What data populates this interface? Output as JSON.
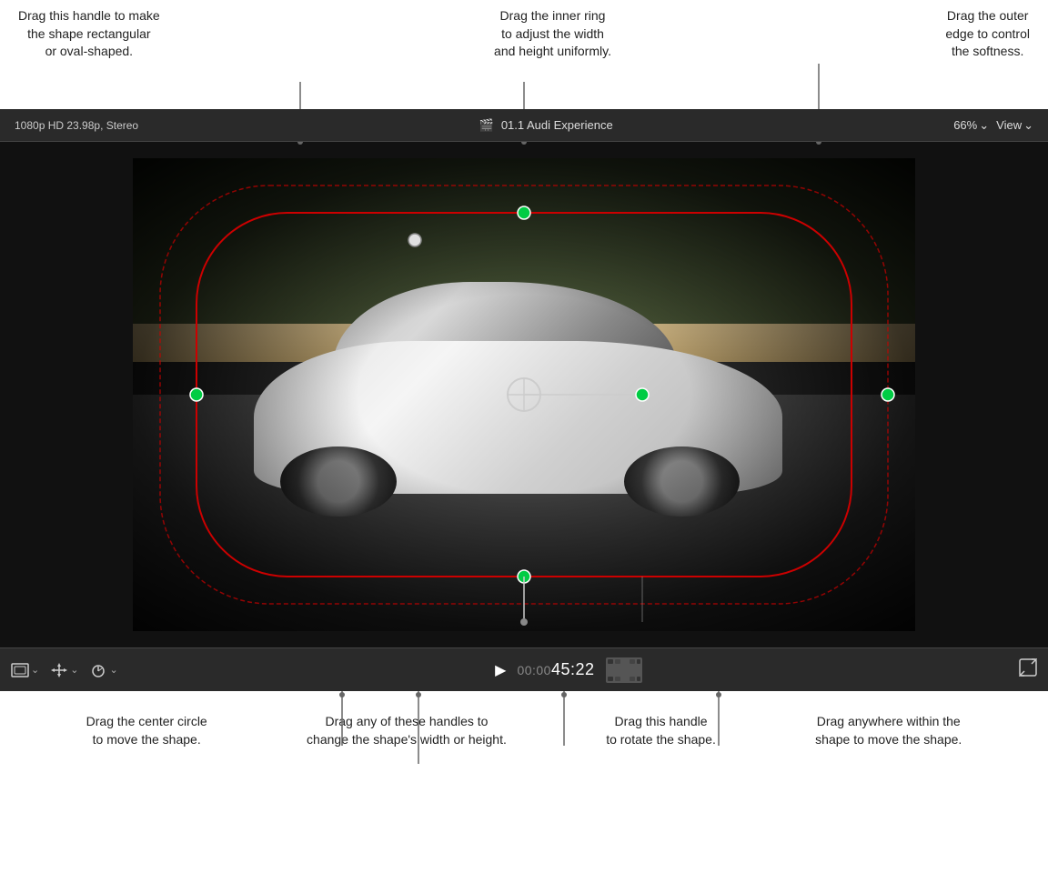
{
  "annotations_top": {
    "left": {
      "line1": "Drag this handle to make",
      "line2": "the shape rectangular",
      "line3": "or oval-shaped."
    },
    "center": {
      "line1": "Drag the inner ring",
      "line2": "to adjust the width",
      "line3": "and height uniformly."
    },
    "right": {
      "line1": "Drag the outer",
      "line2": "edge to control",
      "line3": "the softness."
    }
  },
  "video_header": {
    "format": "1080p HD 23.98p, Stereo",
    "clip_icon": "🎬",
    "clip_title": "01.1 Audi Experience",
    "zoom": "66%",
    "zoom_dropdown_arrow": "⌄",
    "view_label": "View",
    "view_dropdown_arrow": "⌄"
  },
  "video_controls": {
    "crop_icon": "⬜",
    "transform_icon": "✛",
    "speed_icon": "⏱",
    "play_icon": "▶",
    "timecode_prefix": "00:00",
    "timecode_main": "45:22",
    "expand_icon": "⤢"
  },
  "annotations_bottom": {
    "center_circle": {
      "line1": "Drag the center circle",
      "line2": "to move the shape."
    },
    "handles": {
      "line1": "Drag any of these handles to",
      "line2": "change the shape's width or height."
    },
    "rotate": {
      "line1": "Drag this handle",
      "line2": "to rotate the shape."
    },
    "move": {
      "line1": "Drag anywhere within the",
      "line2": "shape to move the shape."
    }
  },
  "mask_shape": {
    "inner_border_color": "#cc0000",
    "outer_border_color": "#cc0000",
    "handle_color": "#00cc00",
    "center_circle_color": "#ffffff"
  }
}
